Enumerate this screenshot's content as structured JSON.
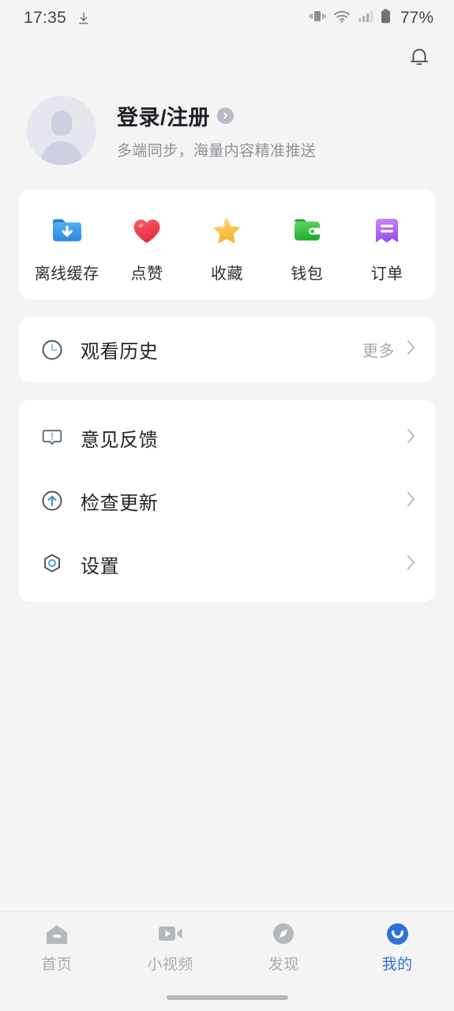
{
  "status_bar": {
    "time": "17:35",
    "battery_percent": "77%",
    "icons": [
      "download-icon",
      "vibrate-icon",
      "wifi-icon",
      "signal-icon",
      "battery-icon"
    ]
  },
  "header": {
    "notification_icon": "bell-icon"
  },
  "profile": {
    "avatar": "default-avatar",
    "title": "登录/注册",
    "subtitle": "多端同步，海量内容精准推送",
    "arrow_icon": "chevron-right-circle-icon"
  },
  "quick_actions": [
    {
      "label": "离线缓存",
      "icon": "download-folder-icon",
      "color": "#3b9bf0"
    },
    {
      "label": "点赞",
      "icon": "heart-icon",
      "color": "#ef4756"
    },
    {
      "label": "收藏",
      "icon": "star-icon",
      "color": "#f6c33c"
    },
    {
      "label": "钱包",
      "icon": "wallet-icon",
      "color": "#35c23f"
    },
    {
      "label": "订单",
      "icon": "receipt-icon",
      "color": "#b濃"
    }
  ],
  "history": {
    "label": "观看历史",
    "icon": "clock-icon",
    "more_label": "更多",
    "more_icon": "chevron-right-icon"
  },
  "menu": [
    {
      "label": "意见反馈",
      "icon": "feedback-icon",
      "chevron": "chevron-right-icon"
    },
    {
      "label": "检查更新",
      "icon": "update-icon",
      "chevron": "chevron-right-icon"
    },
    {
      "label": "设置",
      "icon": "settings-icon",
      "chevron": "chevron-right-icon"
    }
  ],
  "tabbar": {
    "active_color": "#2f71d9",
    "inactive_color": "#a9acb1",
    "items": [
      {
        "label": "首页",
        "icon": "home-icon",
        "active": false
      },
      {
        "label": "小视频",
        "icon": "video-icon",
        "active": false
      },
      {
        "label": "发现",
        "icon": "compass-icon",
        "active": false
      },
      {
        "label": "我的",
        "icon": "profile-smiley-icon",
        "active": true
      }
    ]
  }
}
